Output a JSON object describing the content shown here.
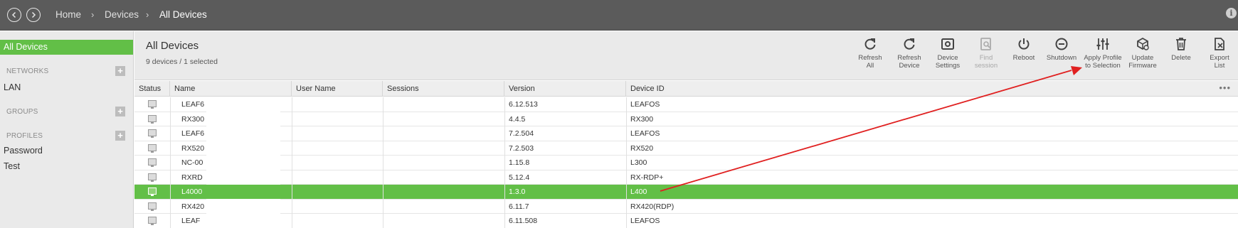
{
  "breadcrumb": {
    "home": "Home",
    "devices": "Devices",
    "current": "All Devices",
    "separator": "›"
  },
  "info_icon": "i",
  "sidebar": {
    "selected": "All Devices",
    "sections": [
      {
        "heading": "NETWORKS",
        "items": [
          "LAN"
        ]
      },
      {
        "heading": "GROUPS",
        "items": []
      },
      {
        "heading": "PROFILES",
        "items": [
          "Password",
          "Test"
        ]
      }
    ],
    "add_symbol": "+"
  },
  "header": {
    "title": "All Devices",
    "subtitle": "9 devices / 1 selected"
  },
  "toolbar": [
    {
      "line1": "Refresh",
      "line2": "All",
      "icon": "refresh-all-icon",
      "enabled": true
    },
    {
      "line1": "Refresh",
      "line2": "Device",
      "icon": "refresh-device-icon",
      "enabled": true
    },
    {
      "line1": "Device",
      "line2": "Settings",
      "icon": "settings-icon",
      "enabled": true
    },
    {
      "line1": "Find",
      "line2": "session",
      "icon": "find-session-icon",
      "enabled": false
    },
    {
      "line1": "Reboot",
      "line2": "",
      "icon": "power-icon",
      "enabled": true
    },
    {
      "line1": "Shutdown",
      "line2": "",
      "icon": "shutdown-icon",
      "enabled": true
    },
    {
      "line1": "Apply Profile",
      "line2": "to Selection",
      "icon": "sliders-icon",
      "enabled": true
    },
    {
      "line1": "Update",
      "line2": "Firmware",
      "icon": "firmware-icon",
      "enabled": true
    },
    {
      "line1": "Delete",
      "line2": "",
      "icon": "trash-icon",
      "enabled": true
    },
    {
      "line1": "Export",
      "line2": "List",
      "icon": "export-icon",
      "enabled": true
    }
  ],
  "table": {
    "columns": [
      "Status",
      "Name",
      "User Name",
      "Sessions",
      "Version",
      "Device ID"
    ],
    "more": "•••",
    "rows": [
      {
        "name": "LEAF6",
        "user": "",
        "sessions": "",
        "version": "6.12.513",
        "device_id": "LEAFOS",
        "selected": false
      },
      {
        "name": "RX300",
        "user": "",
        "sessions": "",
        "version": "4.4.5",
        "device_id": "RX300",
        "selected": false
      },
      {
        "name": "LEAF6",
        "user": "",
        "sessions": "",
        "version": "7.2.504",
        "device_id": "LEAFOS",
        "selected": false
      },
      {
        "name": "RX520",
        "user": "",
        "sessions": "",
        "version": "7.2.503",
        "device_id": "RX520",
        "selected": false
      },
      {
        "name": "NC-00",
        "user": "",
        "sessions": "",
        "version": "1.15.8",
        "device_id": "L300",
        "selected": false
      },
      {
        "name": "RXRD",
        "user": "",
        "sessions": "",
        "version": "5.12.4",
        "device_id": "RX-RDP+",
        "selected": false
      },
      {
        "name": "L4000",
        "user": "",
        "sessions": "",
        "version": "1.3.0",
        "device_id": "L400",
        "selected": true
      },
      {
        "name": "RX420",
        "user": "",
        "sessions": "",
        "version": "6.11.7",
        "device_id": "RX420(RDP)",
        "selected": false
      },
      {
        "name": "LEAF",
        "user": "",
        "sessions": "",
        "version": "6.11.508",
        "device_id": "LEAFOS",
        "selected": false
      }
    ]
  },
  "annotation": {
    "color": "#e02020"
  }
}
